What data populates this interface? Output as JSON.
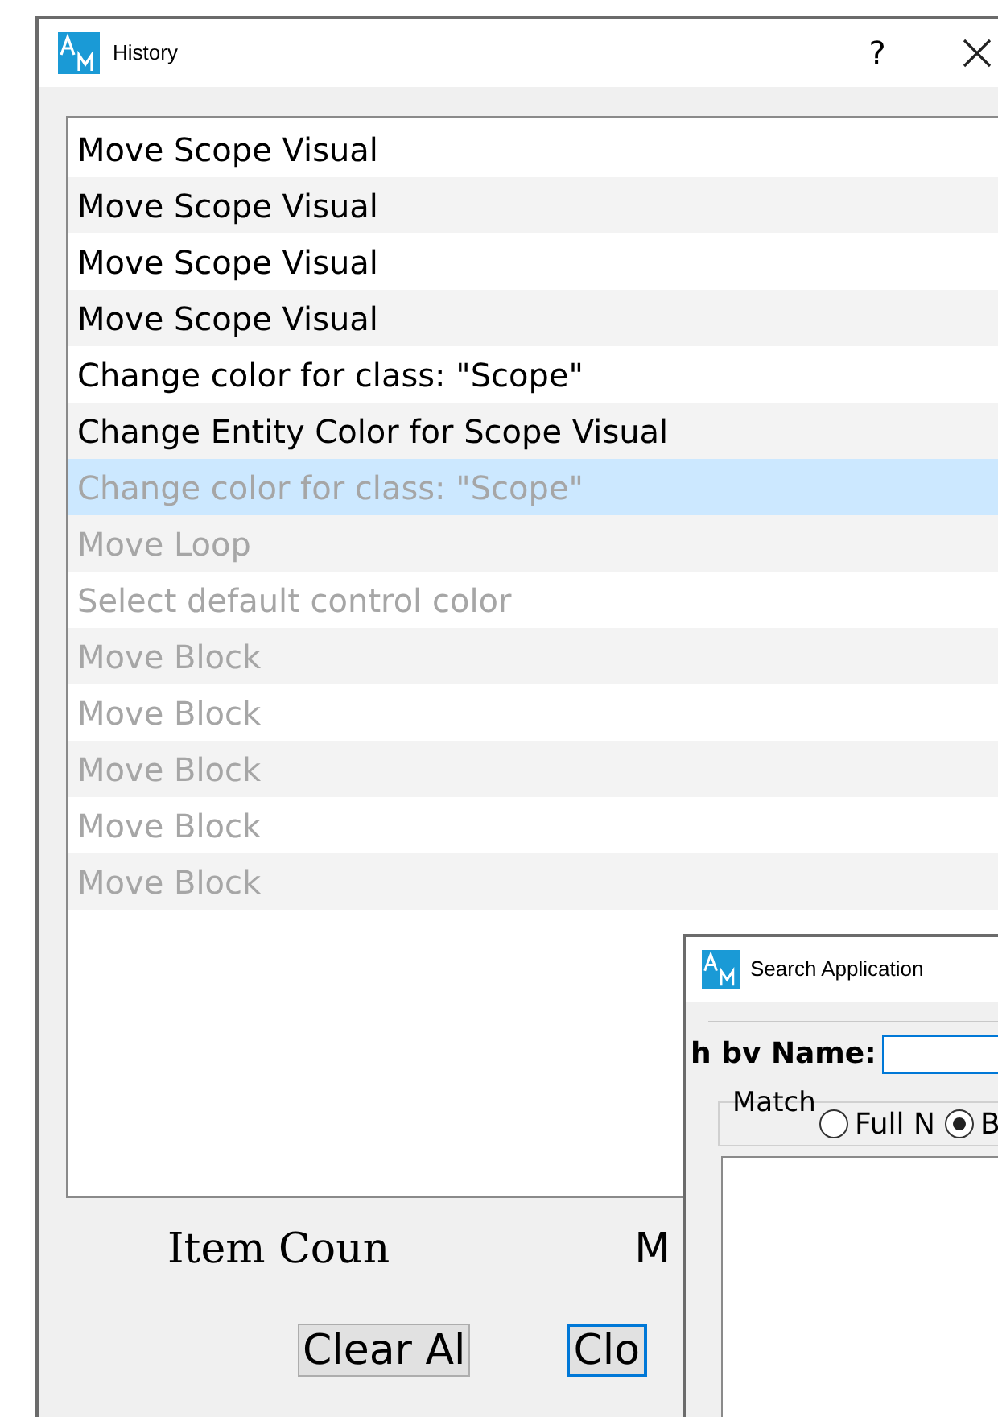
{
  "history_window": {
    "title": "History",
    "help": "?",
    "items": [
      {
        "label": "Move Scope Visual",
        "undone": false,
        "selected": false
      },
      {
        "label": "Move Scope Visual",
        "undone": false,
        "selected": false
      },
      {
        "label": "Move Scope Visual",
        "undone": false,
        "selected": false
      },
      {
        "label": "Move Scope Visual",
        "undone": false,
        "selected": false
      },
      {
        "label": "Change color for class: \"Scope\"",
        "undone": false,
        "selected": false
      },
      {
        "label": "Change Entity Color for Scope Visual",
        "undone": false,
        "selected": false
      },
      {
        "label": "Change color for class: \"Scope\"",
        "undone": true,
        "selected": true
      },
      {
        "label": "Move Loop",
        "undone": true,
        "selected": false
      },
      {
        "label": "Select default control color",
        "undone": true,
        "selected": false
      },
      {
        "label": "Move Block",
        "undone": true,
        "selected": false
      },
      {
        "label": "Move Block",
        "undone": true,
        "selected": false
      },
      {
        "label": "Move Block",
        "undone": true,
        "selected": false
      },
      {
        "label": "Move Block",
        "undone": true,
        "selected": false
      },
      {
        "label": "Move Block",
        "undone": true,
        "selected": false
      }
    ],
    "item_count_label": "Item Coun",
    "label_2": "M",
    "buttons": [
      {
        "label": "Clear Al",
        "focused": false
      },
      {
        "label": "Clo",
        "focused": true
      }
    ]
  },
  "search_window": {
    "title": "Search Application",
    "name_label": "h bv Name:",
    "match_group": "Match",
    "options": [
      {
        "label": "Full N",
        "selected": false
      },
      {
        "label": "B",
        "selected": true
      }
    ]
  }
}
